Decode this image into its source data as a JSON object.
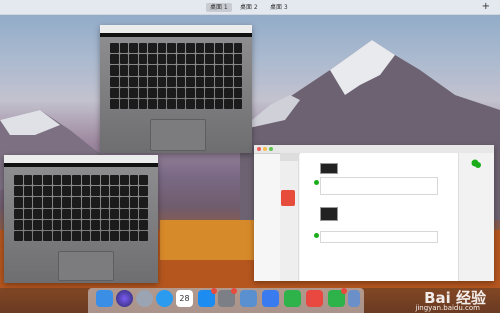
{
  "mission_control": {
    "spaces": [
      {
        "label": "桌面 1",
        "selected": true
      },
      {
        "label": "桌面 2",
        "selected": false
      },
      {
        "label": "桌面 3",
        "selected": false
      }
    ],
    "add_space": "+"
  },
  "windows": [
    {
      "kind": "image-preview",
      "content": "laptop-keyboard-photo"
    },
    {
      "kind": "image-preview",
      "content": "laptop-keyboard-photo"
    },
    {
      "kind": "messaging-app",
      "sidebar_items": [
        "",
        "",
        "",
        ""
      ],
      "messages": [
        {
          "text": "",
          "has_photo": true
        },
        {
          "text": "",
          "has_photo": true
        },
        {
          "text": "",
          "has_photo": false
        }
      ]
    }
  ],
  "dock": {
    "apps": [
      {
        "icon": "finder-icon",
        "color": "#3b8ee6"
      },
      {
        "icon": "siri-icon",
        "color": "#5b4bd6"
      },
      {
        "icon": "launchpad-icon",
        "color": "#9aa4b2"
      },
      {
        "icon": "safari-icon",
        "color": "#2a9bef"
      },
      {
        "icon": "calendar-icon",
        "color": "#ffffff",
        "text": "28"
      },
      {
        "icon": "app-store-icon",
        "color": "#1d8cf0",
        "badge": true
      },
      {
        "icon": "system-preferences-icon",
        "color": "#7d7f86",
        "badge": true
      },
      {
        "icon": "image-capture-icon",
        "color": "#5a8fd0"
      },
      {
        "icon": "feishu-icon",
        "color": "#3a7cf0"
      },
      {
        "icon": "play-icon",
        "color": "#2db34a"
      },
      {
        "icon": "app-icon",
        "color": "#e8483f"
      },
      {
        "icon": "wechat-icon",
        "color": "#2db34a",
        "badge": true
      },
      {
        "icon": "preview-icon",
        "color": "#6b90c9"
      }
    ]
  },
  "watermark": {
    "brand": "Bai 经验",
    "url": "jingyan.baidu.com"
  }
}
